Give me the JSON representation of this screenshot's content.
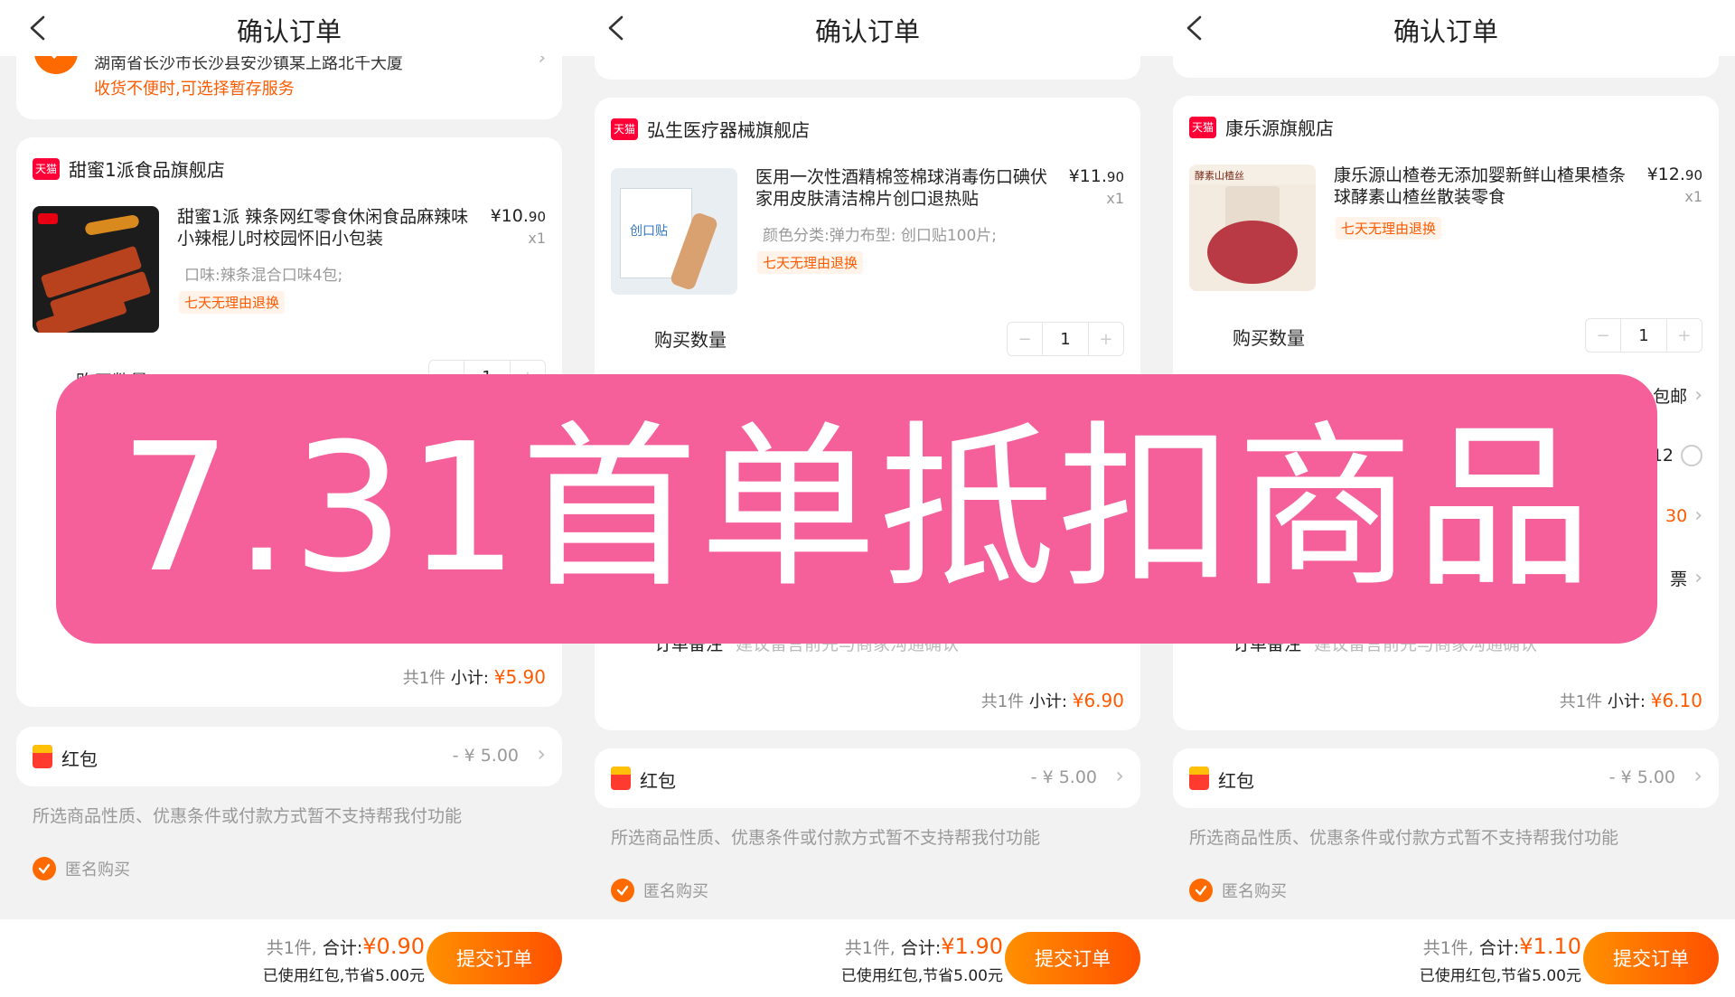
{
  "banner_text": "7.31首单抵扣商品",
  "panels": [
    {
      "title": "确认订单",
      "address": {
        "text": "湖南省长沙市长沙县安沙镇某上路北千大厦",
        "tip": "收货不便时,可选择暂存服务"
      },
      "store": {
        "badge": "天猫",
        "name": "甜蜜1派食品旗舰店",
        "product_title": "甜蜜1派 辣条网红零食休闲食品麻辣味小辣棍儿时校园怀旧小包装",
        "price_main": "¥10.",
        "price_dec": "90",
        "qty": "x1",
        "spec": "口味:辣条混合口味4包;",
        "tag": "七天无理由退换",
        "qty_label": "购买数量",
        "stepper_minus": "−",
        "stepper_value": "1",
        "stepper_plus": "+",
        "subtotal_count": "共1件",
        "subtotal_label": "小计:",
        "subtotal_amount": "¥5.90"
      },
      "hongbao": {
        "label": "红包",
        "value": "- ¥ 5.00"
      },
      "notice": "所选商品性质、优惠条件或付款方式暂不支持帮我付功能",
      "anon_label": "匿名购买",
      "bottom": {
        "count": "共1件,",
        "total_label": "合计:",
        "total_amount": "¥0.90",
        "saved": "已使用红包,节省5.00元",
        "submit": "提交订单"
      }
    },
    {
      "title": "确认订单",
      "store": {
        "badge": "天猫",
        "name": "弘生医疗器械旗舰店",
        "product_title": "医用一次性酒精棉签棉球消毒伤口碘伏家用皮肤清洁棉片创口退热贴",
        "price_main": "¥11.",
        "price_dec": "90",
        "qty": "x1",
        "spec": "颜色分类:弹力布型: 创口贴100片;",
        "tag": "七天无理由退换",
        "img_label": "创口贴",
        "qty_label": "购买数量",
        "stepper_minus": "−",
        "stepper_value": "1",
        "stepper_plus": "+",
        "remark_label": "订单备注",
        "remark_placeholder": "建议留言前先与商家沟通确认",
        "subtotal_count": "共1件",
        "subtotal_label": "小计:",
        "subtotal_amount": "¥6.90"
      },
      "hongbao": {
        "label": "红包",
        "value": "- ¥ 5.00"
      },
      "notice": "所选商品性质、优惠条件或付款方式暂不支持帮我付功能",
      "anon_label": "匿名购买",
      "bottom": {
        "count": "共1件,",
        "total_label": "合计:",
        "total_amount": "¥1.90",
        "saved": "已使用红包,节省5.00元",
        "submit": "提交订单"
      }
    },
    {
      "title": "确认订单",
      "store": {
        "badge": "天猫",
        "name": "康乐源旗舰店",
        "product_title": "康乐源山楂卷无添加婴新鲜山楂果楂条球酵素山楂丝散装零食",
        "price_main": "¥12.",
        "price_dec": "90",
        "qty": "x1",
        "tag": "七天无理由退换",
        "img_label": "酵素山楂丝",
        "qty_label": "购买数量",
        "stepper_minus": "−",
        "stepper_value": "1",
        "stepper_plus": "+",
        "side_rows": [
          "包邮",
          "12",
          "30",
          "票"
        ],
        "remark_label": "订单备注",
        "remark_placeholder": "建议留言前先与商家沟通确认",
        "subtotal_count": "共1件",
        "subtotal_label": "小计:",
        "subtotal_amount": "¥6.10"
      },
      "hongbao": {
        "label": "红包",
        "value": "- ¥ 5.00"
      },
      "notice": "所选商品性质、优惠条件或付款方式暂不支持帮我付功能",
      "anon_label": "匿名购买",
      "bottom": {
        "count": "共1件,",
        "total_label": "合计:",
        "total_amount": "¥1.10",
        "saved": "已使用红包,节省5.00元",
        "submit": "提交订单"
      }
    }
  ]
}
